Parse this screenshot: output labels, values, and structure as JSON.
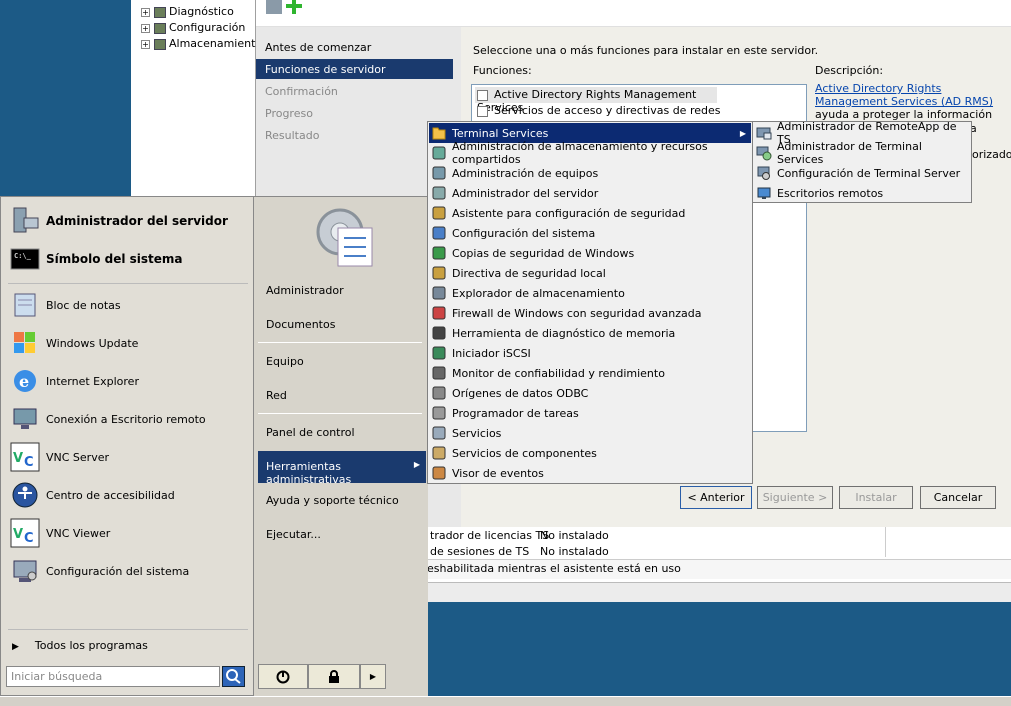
{
  "tree": {
    "items": [
      "Diagnóstico",
      "Configuración",
      "Almacenamiento"
    ]
  },
  "wizard": {
    "steps": [
      "Antes de comenzar",
      "Funciones de servidor",
      "Confirmación",
      "Progreso",
      "Resultado"
    ],
    "instruction": "Seleccione una o más funciones para instalar en este servidor.",
    "roles_label": "Funciones:",
    "roles": [
      "Active Directory Rights Management Services",
      "Servicios de acceso y directivas de redes"
    ],
    "description_label": "Descripción:",
    "description_link": "Active Directory Rights Management Services (AD RMS)",
    "description_text": "ayuda a proteger la información frente a un uso no",
    "desc_tail_1": "a",
    "desc_tail_2": "orizados",
    "buttons": {
      "back": "< Anterior",
      "next": "Siguiente >",
      "install": "Instalar",
      "cancel": "Cancelar"
    },
    "table": [
      {
        "name": "trador de licencias TS",
        "status": "No instalado"
      },
      {
        "name": "de sesiones de TS",
        "status": "No instalado"
      }
    ],
    "status_text": "eshabilitada mientras el asistente está en uso"
  },
  "start_menu": {
    "pinned": [
      {
        "label": "Administrador del servidor",
        "icon": "server-manager-icon"
      },
      {
        "label": "Símbolo del sistema",
        "icon": "command-prompt-icon"
      }
    ],
    "recent": [
      {
        "label": "Bloc de notas",
        "icon": "notepad-icon"
      },
      {
        "label": "Windows Update",
        "icon": "windows-update-icon"
      },
      {
        "label": "Internet Explorer",
        "icon": "internet-explorer-icon"
      },
      {
        "label": "Conexión a Escritorio remoto",
        "icon": "remote-desktop-icon"
      },
      {
        "label": "VNC Server",
        "icon": "vnc-icon"
      },
      {
        "label": "Centro de accesibilidad",
        "icon": "accessibility-icon"
      },
      {
        "label": "VNC Viewer",
        "icon": "vnc-icon"
      },
      {
        "label": "Configuración del sistema",
        "icon": "msconfig-icon"
      }
    ],
    "all_programs": "Todos los programas",
    "search_placeholder": "Iniciar búsqueda",
    "right": [
      "Administrador",
      "Documentos",
      "Equipo",
      "Red",
      "Panel de control",
      "Herramientas administrativas",
      "Ayuda y soporte técnico",
      "Ejecutar..."
    ]
  },
  "admin_tools": [
    "Terminal Services",
    "Administración de almacenamiento y recursos compartidos",
    "Administración de equipos",
    "Administrador del servidor",
    "Asistente para configuración de seguridad",
    "Configuración del sistema",
    "Copias de seguridad de Windows",
    "Directiva de seguridad local",
    "Explorador de almacenamiento",
    "Firewall de Windows con seguridad avanzada",
    "Herramienta de diagnóstico de memoria",
    "Iniciador iSCSI",
    "Monitor de confiabilidad y rendimiento",
    "Orígenes de datos ODBC",
    "Programador de tareas",
    "Servicios",
    "Servicios de componentes",
    "Visor de eventos"
  ],
  "terminal_services": [
    "Administrador de RemoteApp de TS",
    "Administrador de Terminal Services",
    "Configuración de Terminal Server",
    "Escritorios remotos"
  ],
  "colors": {
    "highlight": "#0c2a72",
    "desktop": "#1c5a86"
  }
}
